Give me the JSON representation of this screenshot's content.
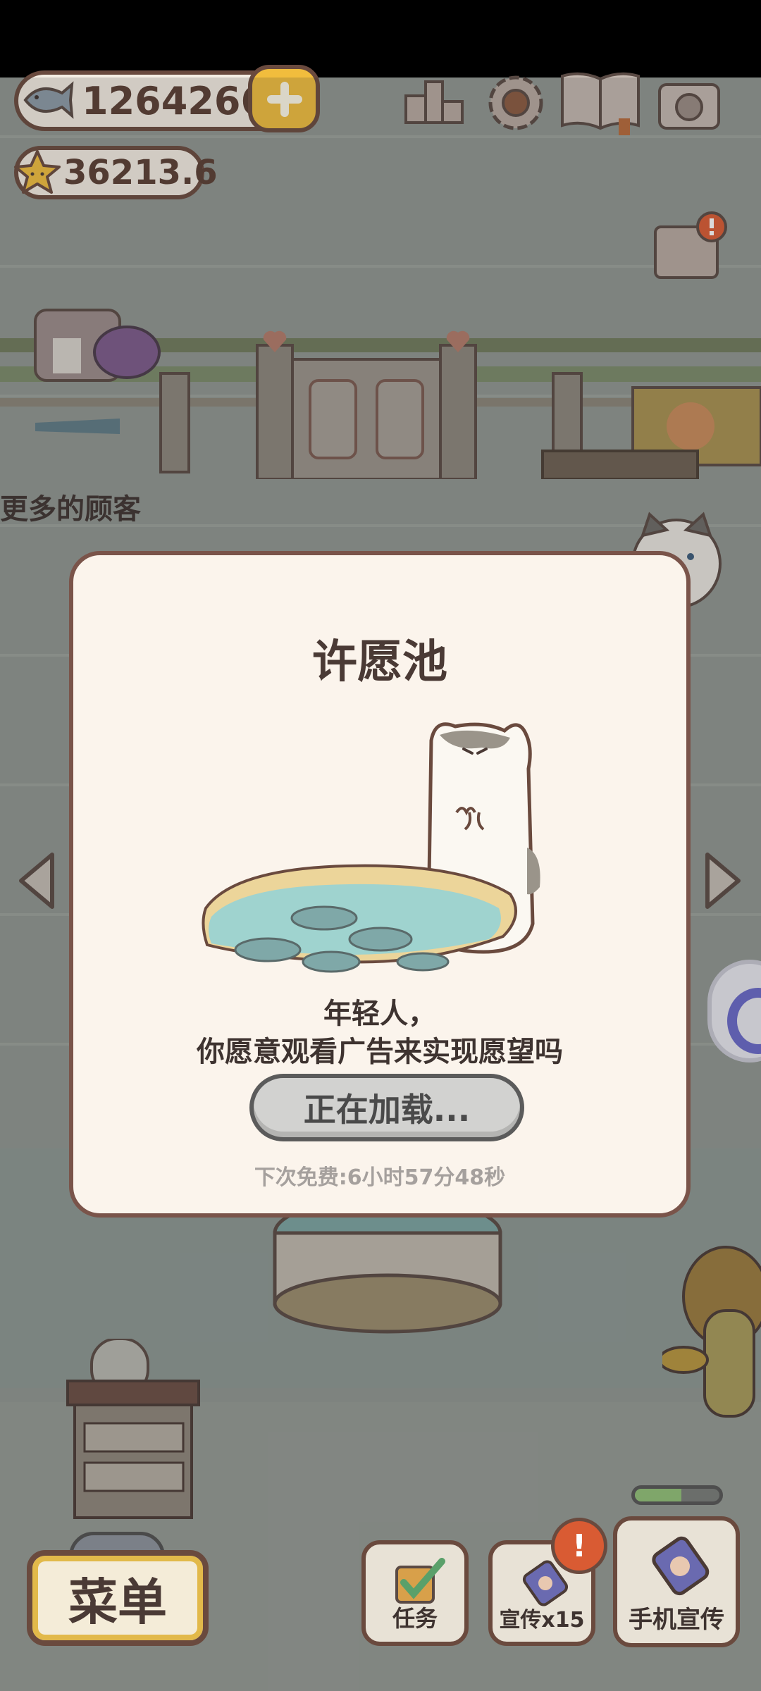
{
  "hud": {
    "fish_count": "1264266",
    "star_count": "36213.6"
  },
  "scene": {
    "hint_text": "更多的顾客"
  },
  "dialog": {
    "title": "许愿池",
    "message_line1": "年轻人，",
    "message_line2": "你愿意观看广告来实现愿望吗",
    "button_label": "正在加载...",
    "timer_text": "下次免费:6小时57分48秒"
  },
  "bottom_bar": {
    "menu_label": "菜单",
    "task_label": "任务",
    "promo_label": "宣传x15",
    "phone_promo_label": "手机宣传",
    "alert_badge": "!",
    "promo_progress": 0.55
  },
  "icons": {
    "fish": "fish-icon",
    "star": "star-icon",
    "plus": "plus-icon",
    "ranking": "ranking-icon",
    "settings": "gear-icon",
    "catbook": "book-icon",
    "camera": "camera-icon",
    "mail": "mail-icon",
    "nav_left": "chevron-left-icon",
    "nav_right": "chevron-right-icon"
  }
}
